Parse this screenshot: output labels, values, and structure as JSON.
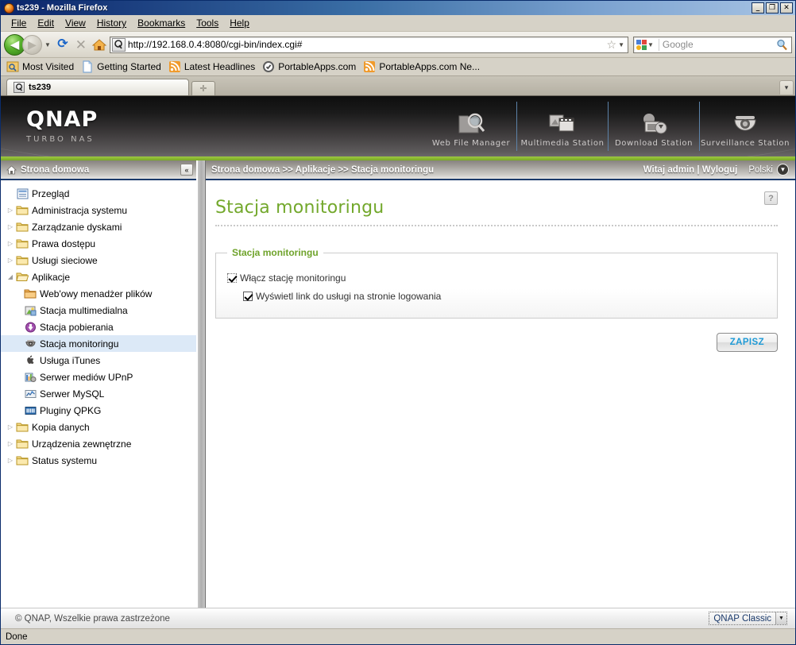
{
  "window": {
    "title": "ts239 - Mozilla Firefox",
    "app_icon": "firefox-icon",
    "minimize": "_",
    "maximize": "❐",
    "close": "✕"
  },
  "menu": {
    "items": [
      {
        "label": "File"
      },
      {
        "label": "Edit"
      },
      {
        "label": "View"
      },
      {
        "label": "History"
      },
      {
        "label": "Bookmarks"
      },
      {
        "label": "Tools"
      },
      {
        "label": "Help"
      }
    ]
  },
  "toolbar": {
    "back": "◀",
    "forward": "▶",
    "history_caret": "▼",
    "reload": "⟳",
    "stop": "✕",
    "home": "home-icon",
    "url": "http://192.168.0.4:8080/cgi-bin/index.cgi#",
    "bookmark_star": "☆",
    "bookmark_caret": "▼",
    "search_placeholder": "Google",
    "search_engine": "google-icon",
    "search_go": "magnifier-icon"
  },
  "bookmarks": [
    {
      "label": "Most Visited",
      "icon": "most-visited-icon"
    },
    {
      "label": "Getting Started",
      "icon": "page-icon"
    },
    {
      "label": "Latest Headlines",
      "icon": "rss-icon"
    },
    {
      "label": "PortableApps.com",
      "icon": "portableapps-icon"
    },
    {
      "label": "PortableApps.com Ne...",
      "icon": "rss-icon"
    }
  ],
  "tabs": {
    "items": [
      {
        "label": "ts239",
        "icon": "qnap-favicon"
      }
    ],
    "new_tab": "✛",
    "tab_list": "▾"
  },
  "banner": {
    "brand": "QNAP",
    "subtitle": "TURBO NAS",
    "stations": [
      {
        "label": "Web File Manager",
        "icon": "folder-search-icon"
      },
      {
        "label": "Multimedia Station",
        "icon": "photo-film-icon"
      },
      {
        "label": "Download Station",
        "icon": "download-icon"
      },
      {
        "label": "Surveillance Station",
        "icon": "dome-camera-icon"
      }
    ]
  },
  "sidebar": {
    "header": "Strona domowa",
    "header_icon": "home-icon",
    "collapse": "«",
    "items": [
      {
        "label": "Przegląd",
        "icon": "overview-icon",
        "twisty": "",
        "indent": 1,
        "selected": false
      },
      {
        "label": "Administracja systemu",
        "icon": "folder-icon",
        "twisty": "▷",
        "indent": 0,
        "selected": false
      },
      {
        "label": "Zarządzanie dyskami",
        "icon": "folder-icon",
        "twisty": "▷",
        "indent": 0,
        "selected": false
      },
      {
        "label": "Prawa dostępu",
        "icon": "folder-icon",
        "twisty": "▷",
        "indent": 0,
        "selected": false
      },
      {
        "label": "Usługi sieciowe",
        "icon": "folder-icon",
        "twisty": "▷",
        "indent": 0,
        "selected": false
      },
      {
        "label": "Aplikacje",
        "icon": "folder-open-icon",
        "twisty": "◢",
        "indent": 0,
        "selected": false
      },
      {
        "label": "Web'owy menadżer plików",
        "icon": "folder-orange-icon",
        "twisty": "",
        "indent": 2,
        "selected": false
      },
      {
        "label": "Stacja multimedialna",
        "icon": "multimedia-icon",
        "twisty": "",
        "indent": 2,
        "selected": false
      },
      {
        "label": "Stacja pobierania",
        "icon": "download-circle-icon",
        "twisty": "",
        "indent": 2,
        "selected": false
      },
      {
        "label": "Stacja monitoringu",
        "icon": "camera-icon",
        "twisty": "",
        "indent": 2,
        "selected": true
      },
      {
        "label": "Usługa iTunes",
        "icon": "apple-icon",
        "twisty": "",
        "indent": 2,
        "selected": false
      },
      {
        "label": "Serwer mediów UPnP",
        "icon": "upnp-icon",
        "twisty": "",
        "indent": 2,
        "selected": false
      },
      {
        "label": "Serwer MySQL",
        "icon": "mysql-icon",
        "twisty": "",
        "indent": 2,
        "selected": false
      },
      {
        "label": "Pluginy QPKG",
        "icon": "qpkg-icon",
        "twisty": "",
        "indent": 2,
        "selected": false
      },
      {
        "label": "Kopia danych",
        "icon": "folder-icon",
        "twisty": "▷",
        "indent": 0,
        "selected": false
      },
      {
        "label": "Urządzenia zewnętrzne",
        "icon": "folder-icon",
        "twisty": "▷",
        "indent": 0,
        "selected": false
      },
      {
        "label": "Status systemu",
        "icon": "folder-icon",
        "twisty": "▷",
        "indent": 0,
        "selected": false
      }
    ]
  },
  "crumbbar": {
    "breadcrumb": "Strona domowa >> Aplikacje >> Stacja monitoringu",
    "greeting": "Witaj admin | Wyloguj",
    "language": "Polski",
    "language_caret": "▼"
  },
  "page": {
    "title": "Stacja monitoringu",
    "help": "?",
    "panel_legend": "Stacja monitoringu",
    "checkbox_enable": "Włącz stację monitoringu",
    "checkbox_show_link": "Wyświetl link do usługi na stronie logowania",
    "save_button": "ZAPISZ"
  },
  "page_footer": {
    "copyright": "© QNAP, Wszelkie prawa zastrzeżone",
    "theme": "QNAP Classic",
    "theme_caret": "▼"
  },
  "statusbar": {
    "text": "Done"
  },
  "colors": {
    "accent_green": "#73a82c",
    "titlebar_blue": "#0a246a",
    "selection_blue": "#dce9f7",
    "save_label_blue": "#1e9ad6"
  }
}
